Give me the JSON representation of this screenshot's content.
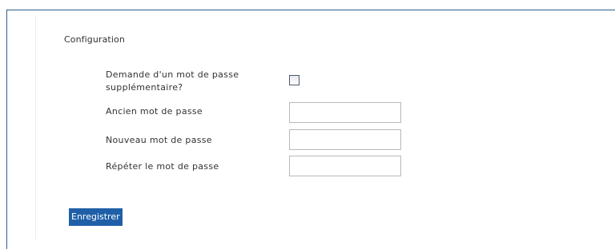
{
  "section": {
    "title": "Configuration"
  },
  "form": {
    "extra_password_label": "Demande d'un mot de passe supplémentaire?",
    "extra_password_checked": false,
    "old_password_label": "Ancien mot de passe",
    "old_password_value": "",
    "new_password_label": "Nouveau mot de passe",
    "new_password_value": "",
    "repeat_password_label": "Répéter le mot de passe",
    "repeat_password_value": ""
  },
  "actions": {
    "save_label": "Enregistrer"
  },
  "colors": {
    "frame_border": "#2f5f8f",
    "button_background": "#1f5fa8",
    "button_text": "#ffffff"
  }
}
